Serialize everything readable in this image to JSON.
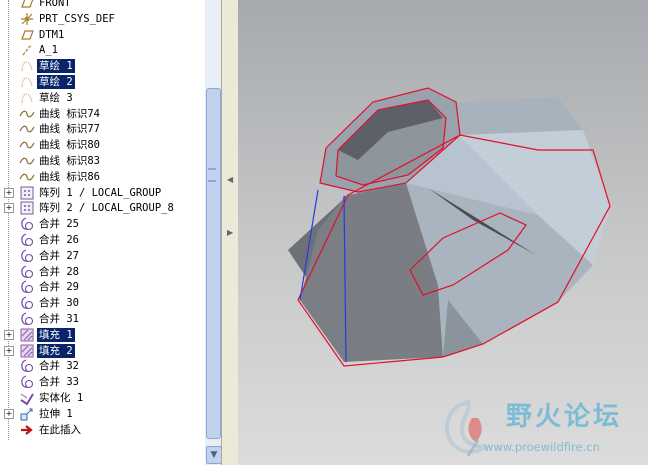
{
  "model_tree": {
    "items": [
      {
        "label": "FRONT",
        "icon": "datum-plane-icon",
        "expandable": false,
        "selected": false
      },
      {
        "label": "PRT_CSYS_DEF",
        "icon": "coordinate-system-icon",
        "expandable": false,
        "selected": false
      },
      {
        "label": "DTM1",
        "icon": "datum-plane-icon",
        "expandable": false,
        "selected": false
      },
      {
        "label": "A_1",
        "icon": "datum-axis-icon",
        "expandable": false,
        "selected": false
      },
      {
        "label": "草绘 1",
        "icon": "sketch-icon",
        "expandable": false,
        "selected": true
      },
      {
        "label": "草绘 2",
        "icon": "sketch-icon",
        "expandable": false,
        "selected": true
      },
      {
        "label": "草绘 3",
        "icon": "sketch-icon",
        "expandable": false,
        "selected": false
      },
      {
        "label": "曲线 标识74",
        "icon": "curve-icon",
        "expandable": false,
        "selected": false
      },
      {
        "label": "曲线 标识77",
        "icon": "curve-icon",
        "expandable": false,
        "selected": false
      },
      {
        "label": "曲线 标识80",
        "icon": "curve-icon",
        "expandable": false,
        "selected": false
      },
      {
        "label": "曲线 标识83",
        "icon": "curve-icon",
        "expandable": false,
        "selected": false
      },
      {
        "label": "曲线 标识86",
        "icon": "curve-icon",
        "expandable": false,
        "selected": false
      },
      {
        "label": "阵列 1 / LOCAL_GROUP",
        "icon": "pattern-icon",
        "expandable": true,
        "selected": false
      },
      {
        "label": "阵列 2 / LOCAL_GROUP_8",
        "icon": "pattern-icon",
        "expandable": true,
        "selected": false
      },
      {
        "label": "合并 25",
        "icon": "merge-icon",
        "expandable": false,
        "selected": false
      },
      {
        "label": "合并 26",
        "icon": "merge-icon",
        "expandable": false,
        "selected": false
      },
      {
        "label": "合并 27",
        "icon": "merge-icon",
        "expandable": false,
        "selected": false
      },
      {
        "label": "合并 28",
        "icon": "merge-icon",
        "expandable": false,
        "selected": false
      },
      {
        "label": "合并 29",
        "icon": "merge-icon",
        "expandable": false,
        "selected": false
      },
      {
        "label": "合并 30",
        "icon": "merge-icon",
        "expandable": false,
        "selected": false
      },
      {
        "label": "合并 31",
        "icon": "merge-icon",
        "expandable": false,
        "selected": false
      },
      {
        "label": "填充 1",
        "icon": "fill-icon",
        "expandable": true,
        "selected": true
      },
      {
        "label": "填充 2",
        "icon": "fill-icon",
        "expandable": true,
        "selected": true
      },
      {
        "label": "合并 32",
        "icon": "merge-icon",
        "expandable": false,
        "selected": false
      },
      {
        "label": "合并 33",
        "icon": "merge-icon",
        "expandable": false,
        "selected": false
      },
      {
        "label": "实体化 1",
        "icon": "solidify-icon",
        "expandable": false,
        "selected": false
      },
      {
        "label": "拉伸 1",
        "icon": "extrude-icon",
        "expandable": true,
        "selected": false
      },
      {
        "label": "在此插入",
        "icon": "insert-here-arrow-icon",
        "expandable": false,
        "selected": false
      }
    ]
  },
  "scrollbar": {
    "position": 0.3
  },
  "watermark": {
    "title": "野火论坛",
    "url": "www.proewildfire.cn"
  },
  "colors": {
    "selection": "#0a246a",
    "viewport_top": "#a6a9ae",
    "viewport_bottom": "#dcdcdc",
    "edge_highlight": "#e0102a",
    "edge_blue": "#2a3ae0"
  }
}
